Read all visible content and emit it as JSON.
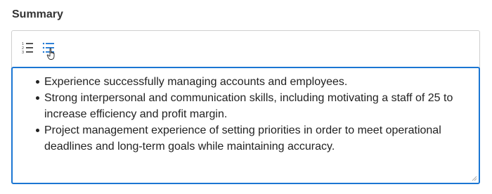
{
  "section": {
    "label": "Summary"
  },
  "toolbar": {
    "numbered_list_icon": "numbered-list-icon",
    "bulleted_list_icon": "bulleted-list-icon",
    "active_tool": "bulleted-list",
    "cursor_icon": "hand-pointer-icon"
  },
  "editor": {
    "bullets": [
      "Experience successfully managing accounts and employees.",
      "Strong interpersonal and communication skills, including motivating a staff of 25 to increase efficiency and profit margin.",
      "Project management experience of setting priorities in order to meet operational deadlines and long-term goals while maintaining accuracy."
    ]
  },
  "colors": {
    "focus_border": "#1b76d3",
    "active_icon": "#1b76d3",
    "border": "#cfcfcf",
    "text": "#222222"
  }
}
